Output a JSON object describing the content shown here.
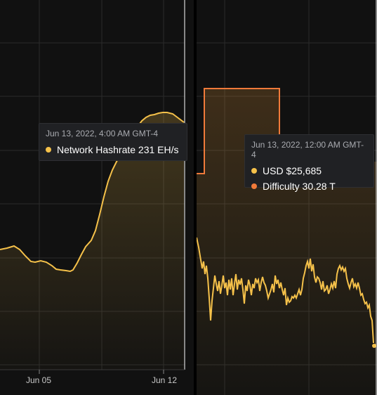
{
  "left_chart": {
    "tooltip": {
      "time": "Jun 13, 2022, 4:00 AM GMT-4",
      "series_label": "Network Hashrate",
      "value": "231 EH/s",
      "text": "Network Hashrate 231 EH/s"
    },
    "x_ticks": [
      "Jun 05",
      "Jun 12"
    ]
  },
  "right_chart": {
    "tooltip": {
      "time": "Jun 13, 2022, 12:00 AM GMT-4",
      "usd_label": "USD $25,685",
      "difficulty_label": "Difficulty 30.28 T"
    }
  },
  "colors": {
    "background": "#111111",
    "grid": "#2a2a2a",
    "series_yellow": "#f5c14a",
    "series_orange": "#f07a3a",
    "tooltip_bg": "#202124"
  }
}
